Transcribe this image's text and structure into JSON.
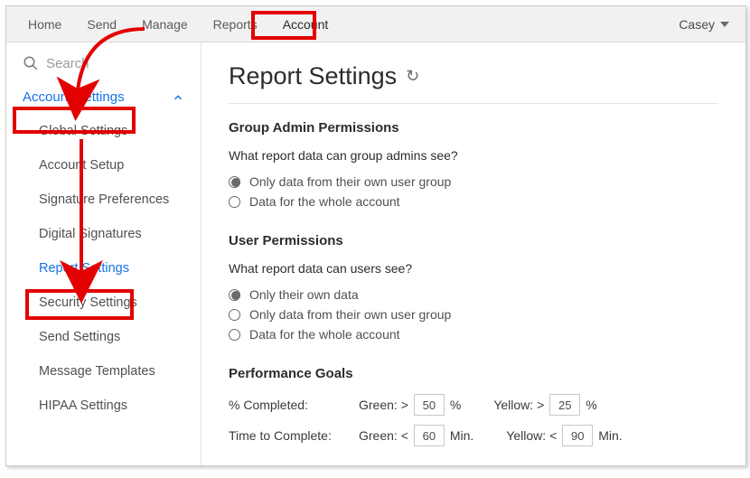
{
  "topnav": {
    "items": [
      "Home",
      "Send",
      "Manage",
      "Reports",
      "Account"
    ],
    "active_index": 4,
    "user_name": "Casey"
  },
  "sidebar": {
    "search_placeholder": "Search",
    "section_label": "Account Settings",
    "items": [
      "Global Settings",
      "Account Setup",
      "Signature Preferences",
      "Digital Signatures",
      "Report Settings",
      "Security Settings",
      "Send Settings",
      "Message Templates",
      "HIPAA Settings"
    ],
    "selected_index": 4
  },
  "main": {
    "title": "Report Settings",
    "group_admin": {
      "heading": "Group Admin Permissions",
      "question": "What report data can group admins see?",
      "options": [
        "Only data from their own user group",
        "Data for the whole account"
      ],
      "selected_index": 0
    },
    "user_perm": {
      "heading": "User Permissions",
      "question": "What report data can users see?",
      "options": [
        "Only their own data",
        "Only data from their own user group",
        "Data for the whole account"
      ],
      "selected_index": 0
    },
    "goals": {
      "heading": "Performance Goals",
      "rows": [
        {
          "label": "% Completed:",
          "g_prefix": "Green: >",
          "g_val": "50",
          "g_unit": "%",
          "y_prefix": "Yellow: >",
          "y_val": "25",
          "y_unit": "%"
        },
        {
          "label": "Time to Complete:",
          "g_prefix": "Green: <",
          "g_val": "60",
          "g_unit": "Min.",
          "y_prefix": "Yellow: <",
          "y_val": "90",
          "y_unit": "Min."
        }
      ]
    }
  }
}
